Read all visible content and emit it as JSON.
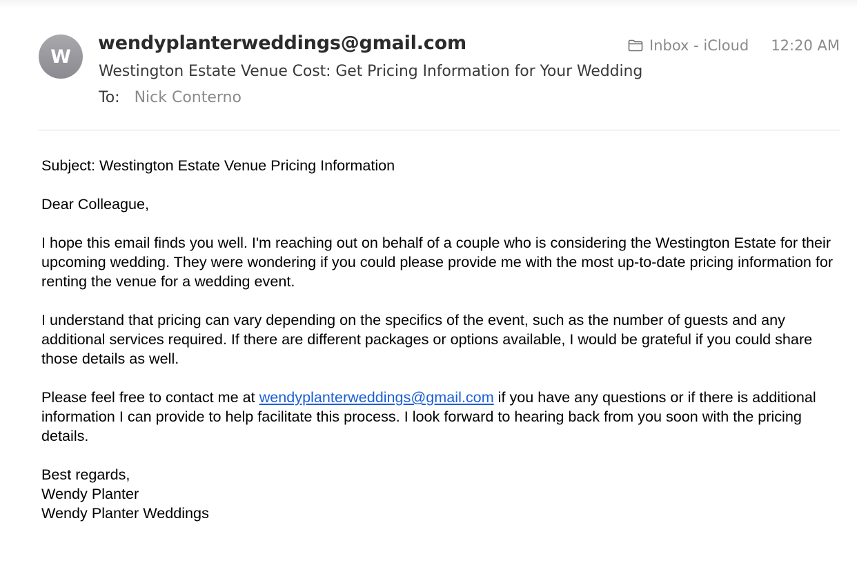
{
  "header": {
    "avatar_initial": "W",
    "sender": "wendyplanterweddings@gmail.com",
    "subject": "Westington Estate Venue Cost: Get Pricing Information for Your Wedding",
    "to_label": "To:",
    "to_value": "Nick Conterno",
    "mailbox": "Inbox - iCloud",
    "mailbox_icon": "folder-icon",
    "time": "12:20 AM"
  },
  "body": {
    "subject_line": "Subject: Westington Estate Venue Pricing Information",
    "greeting": "Dear Colleague,",
    "para1": "I hope this email finds you well. I'm reaching out on behalf of a couple who is considering the Westington Estate for their upcoming wedding. They were wondering if you could please provide me with the most up-to-date pricing information for renting the venue for a wedding event.",
    "para2": "I understand that pricing can vary depending on the specifics of the event, such as the number of guests and any additional services required. If there are different packages or options available, I would be grateful if you could share those details as well.",
    "para3_before": "Please feel free to contact me at ",
    "para3_link": "wendyplanterweddings@gmail.com",
    "para3_after": " if you have any questions or if there is additional information I can provide to help facilitate this process. I look forward to hearing back from you soon with the pricing details.",
    "closing": "Best regards,",
    "signature_name": "Wendy Planter",
    "signature_company": "Wendy Planter Weddings"
  },
  "colors": {
    "link": "#1a5fd6",
    "secondary_text": "#8a8a8e",
    "avatar": "#9a9aa0"
  }
}
